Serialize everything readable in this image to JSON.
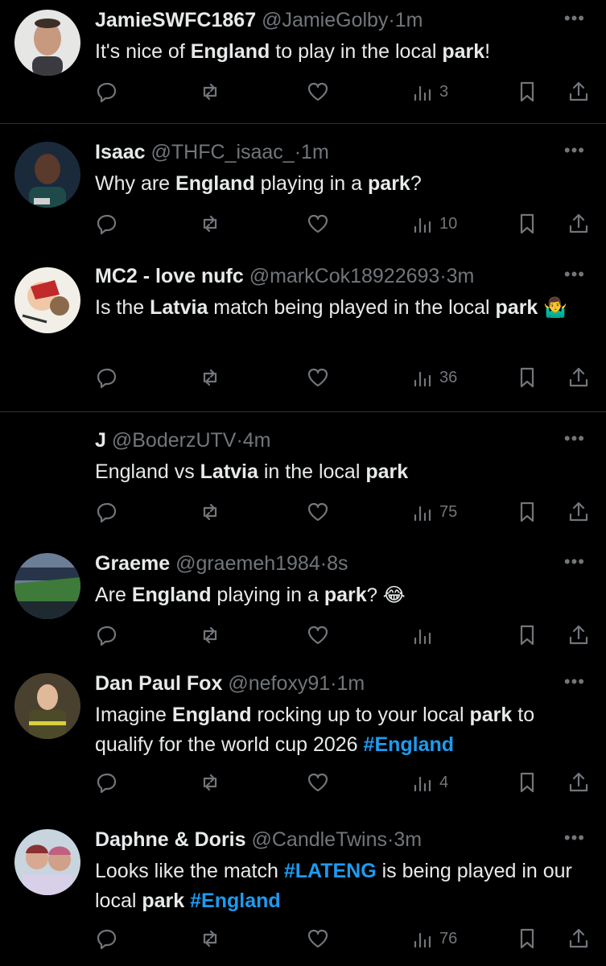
{
  "tweets": [
    {
      "name": "JamieSWFC1867",
      "handle": "@JamieGolby",
      "dot": "·",
      "time": "1m",
      "segments": [
        {
          "t": "It's nice of ",
          "b": false
        },
        {
          "t": "England",
          "b": true
        },
        {
          "t": " to play in the local ",
          "b": false
        },
        {
          "t": "park",
          "b": true
        },
        {
          "t": "!",
          "b": false
        }
      ],
      "views": "3"
    },
    {
      "name": "Isaac",
      "handle": "@THFC_isaac_",
      "dot": "·",
      "time": "1m",
      "segments": [
        {
          "t": "Why are ",
          "b": false
        },
        {
          "t": "England",
          "b": true
        },
        {
          "t": " playing in a ",
          "b": false
        },
        {
          "t": "park",
          "b": true
        },
        {
          "t": "?",
          "b": false
        }
      ],
      "views": "10"
    },
    {
      "name": "MC2 - love nufc",
      "handle": "@markCok18922693",
      "dot": "·",
      "time": "3m",
      "segments": [
        {
          "t": "Is the ",
          "b": false
        },
        {
          "t": "Latvia",
          "b": true
        },
        {
          "t": " match being played in the local ",
          "b": false
        },
        {
          "t": "park",
          "b": true
        },
        {
          "t": " 🤷‍♂️",
          "b": false
        }
      ],
      "views": "36"
    },
    {
      "name": "J",
      "handle": "@BoderzUTV",
      "dot": "·",
      "time": "4m",
      "segments": [
        {
          "t": "England vs ",
          "b": false
        },
        {
          "t": "Latvia",
          "b": true
        },
        {
          "t": " in the local ",
          "b": false
        },
        {
          "t": "park",
          "b": true
        }
      ],
      "views": "75"
    },
    {
      "name": "Graeme",
      "handle": "@graemeh1984",
      "dot": "·",
      "time": "8s",
      "segments": [
        {
          "t": "Are ",
          "b": false
        },
        {
          "t": "England",
          "b": true
        },
        {
          "t": " playing in a ",
          "b": false
        },
        {
          "t": "park",
          "b": true
        },
        {
          "t": "? 😂",
          "b": false
        }
      ],
      "views": ""
    },
    {
      "name": "Dan Paul Fox",
      "handle": "@nefoxy91",
      "dot": "·",
      "time": "1m",
      "segments": [
        {
          "t": "Imagine ",
          "b": false
        },
        {
          "t": "England",
          "b": true
        },
        {
          "t": " rocking up to your local ",
          "b": false
        },
        {
          "t": "park",
          "b": true
        },
        {
          "t": " to qualify for the world cup 2026 ",
          "b": false
        },
        {
          "t": "#England",
          "h": true
        }
      ],
      "views": "4"
    },
    {
      "name": "Daphne & Doris",
      "handle": "@CandleTwins",
      "dot": "·",
      "time": "3m",
      "segments": [
        {
          "t": "Looks like the match ",
          "b": false
        },
        {
          "t": "#LATENG",
          "h": true
        },
        {
          "t": " is being played in our local ",
          "b": false
        },
        {
          "t": "park",
          "b": true
        },
        {
          "t": " ",
          "b": false
        },
        {
          "t": "#England",
          "h": true
        }
      ],
      "views": "76"
    }
  ],
  "ui": {
    "more_glyph": "•••"
  },
  "icons": [
    "reply-icon",
    "retweet-icon",
    "like-icon",
    "views-icon",
    "bookmark-icon",
    "share-icon",
    "more-icon"
  ],
  "colors": {
    "background": "#000000",
    "text": "#e7e9ea",
    "muted": "#71767b",
    "hashtag": "#1d9bf0",
    "divider": "#2f3336"
  }
}
